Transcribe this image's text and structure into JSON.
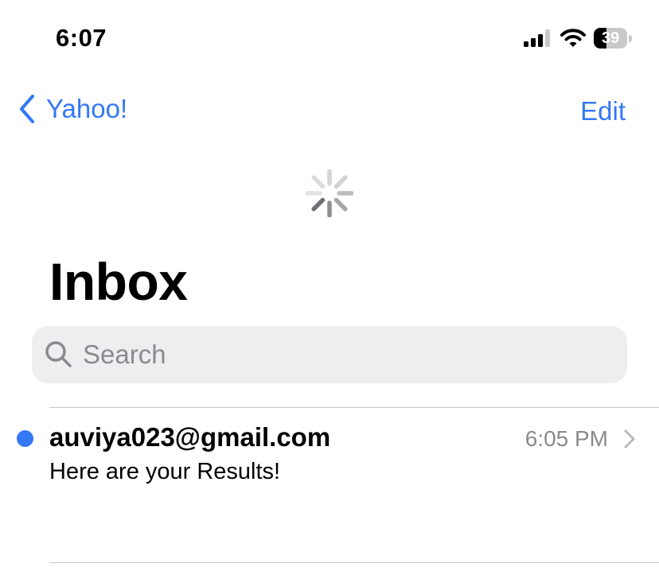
{
  "status_bar": {
    "time": "6:07",
    "battery_level": "39",
    "battery_fraction": 0.39,
    "icons": [
      "cellular-signal-icon",
      "wifi-icon",
      "battery-icon"
    ]
  },
  "nav": {
    "back_label": "Yahoo!",
    "edit_label": "Edit",
    "accent_color": "#3478f6"
  },
  "title": "Inbox",
  "search": {
    "placeholder": "Search",
    "value": ""
  },
  "messages": [
    {
      "sender": "auviya023@gmail.com",
      "time": "6:05 PM",
      "subject": "Here are your Results!",
      "unread": true,
      "unread_color": "#3478f6"
    }
  ]
}
